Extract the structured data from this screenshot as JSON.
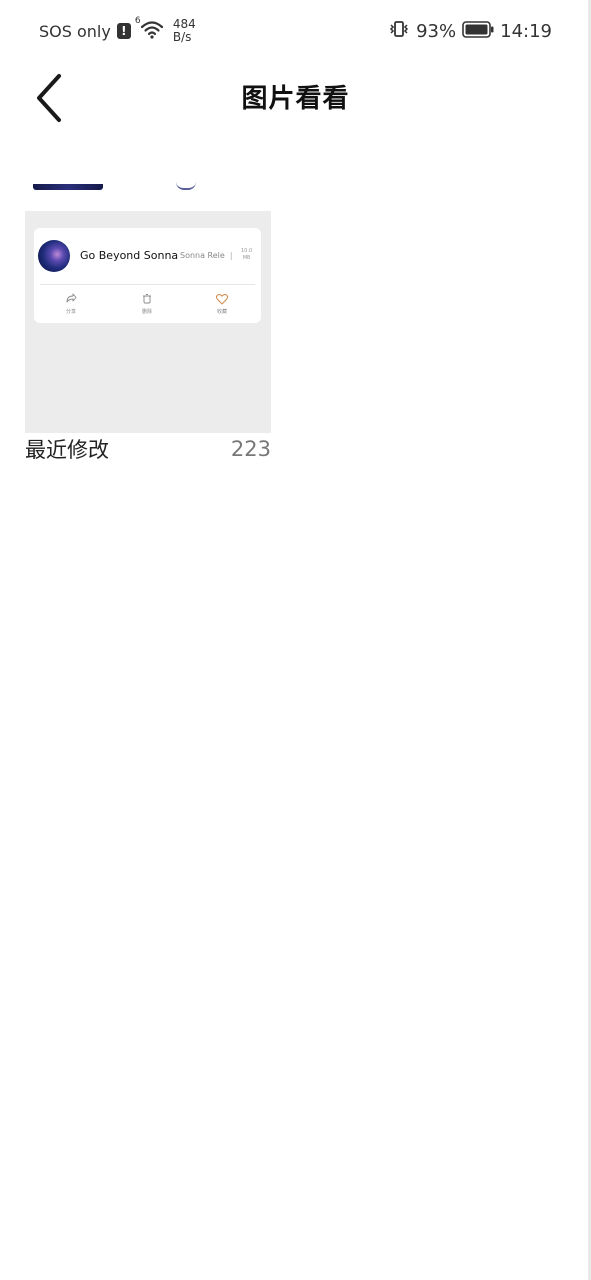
{
  "status_bar": {
    "carrier": "SOS only",
    "alert_badge": "!",
    "wifi_gen": "6",
    "net_speed_value": "484",
    "net_speed_unit": "B/s",
    "battery_percent": "93%",
    "time": "14:19"
  },
  "app_bar": {
    "title": "图片看看"
  },
  "albums": [
    {
      "name": "最近修改",
      "count": "223",
      "preview": {
        "title": "Go Beyond Sonna",
        "subtitle": "Sonna Rele",
        "size_value": "10.0",
        "size_unit": "MB",
        "actions": [
          {
            "label": "分享",
            "icon": "share-icon"
          },
          {
            "label": "删除",
            "icon": "trash-icon"
          },
          {
            "label": "收藏",
            "icon": "heart-icon"
          }
        ]
      }
    }
  ],
  "colors": {
    "thumb_bg": "#ececec",
    "heart": "#d08a4a"
  }
}
